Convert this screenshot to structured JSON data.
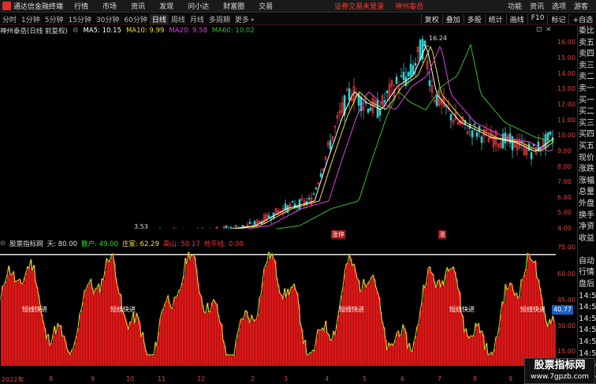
{
  "titlebar": {
    "app_name": "通达信金融终端",
    "menus": [
      "行情",
      "市场",
      "资讯",
      "发现",
      "问小达",
      "财富圈",
      "交易"
    ],
    "notice": "证券交易未登录",
    "stock_link": "神州泰岳",
    "tools": [
      "功能",
      "资讯",
      "选项",
      "游客"
    ]
  },
  "toolbar": {
    "periods": [
      "分时",
      "1分钟",
      "5分钟",
      "15分钟",
      "30分钟",
      "60分钟",
      "日线",
      "周线",
      "月线",
      "多周期",
      "更多"
    ],
    "active_period": "日线",
    "right_buttons": [
      "复权",
      "叠加",
      "多股",
      "统计",
      "画线",
      "F10",
      "标记",
      "+自选"
    ]
  },
  "infobar": {
    "title": "神州泰岳(日线 前复权)",
    "ma5": "MA5: 10.15",
    "ma10": "MA10: 9.99",
    "ma20": "MA20: 9.58",
    "ma60": "MA60: 10.02",
    "colors": {
      "ma5": "#ffffff",
      "ma10": "#f0e030",
      "ma20": "#e040e0",
      "ma60": "#30c030"
    }
  },
  "price_chart": {
    "high_label": "16.24",
    "low_label": "3.53",
    "tags": [
      "涨停",
      "涨"
    ],
    "y_ticks": [
      "16.00",
      "15.00",
      "14.00",
      "13.00",
      "12.00",
      "11.00",
      "10.00",
      "9.00",
      "8.00",
      "7.00",
      "6.00",
      "5.00",
      "4.00"
    ]
  },
  "indicator": {
    "name": "股票指标网",
    "period": "天: 80.00",
    "retail": "散户: 49.00",
    "dealer": "庄家: 62.29",
    "hill": "高山: 50.17",
    "ground": "地平线: 0.00",
    "current_value": "40.77",
    "labels": [
      "短线快进",
      "短线快进",
      "短线快进",
      "短线快进",
      "短线快进"
    ],
    "y_ticks": [
      "75.00",
      "60.00",
      "45.00",
      "30.00",
      "15.00"
    ]
  },
  "xaxis": {
    "labels": [
      "2022年",
      "8",
      "9",
      "10",
      "11",
      "12",
      "2",
      "3",
      "4",
      "5",
      "6",
      "7",
      "8",
      "9"
    ]
  },
  "sidebar": {
    "items": [
      "委比",
      "卖五",
      "卖四",
      "卖三",
      "卖二",
      "卖一",
      "买一",
      "买二",
      "买三",
      "买四",
      "买五",
      "现价",
      "涨跌",
      "涨幅",
      "总量",
      "外盘",
      "换手",
      "净资",
      "收益",
      "",
      "自动",
      "行情",
      "盘后",
      "14:5",
      "14:5",
      "14:5",
      "14:5",
      "14:5",
      "14:5",
      "14:5",
      "14:5",
      "14:5"
    ]
  },
  "watermark": {
    "line1": "股票指标网",
    "line2": "www.7gpzb.com"
  }
}
